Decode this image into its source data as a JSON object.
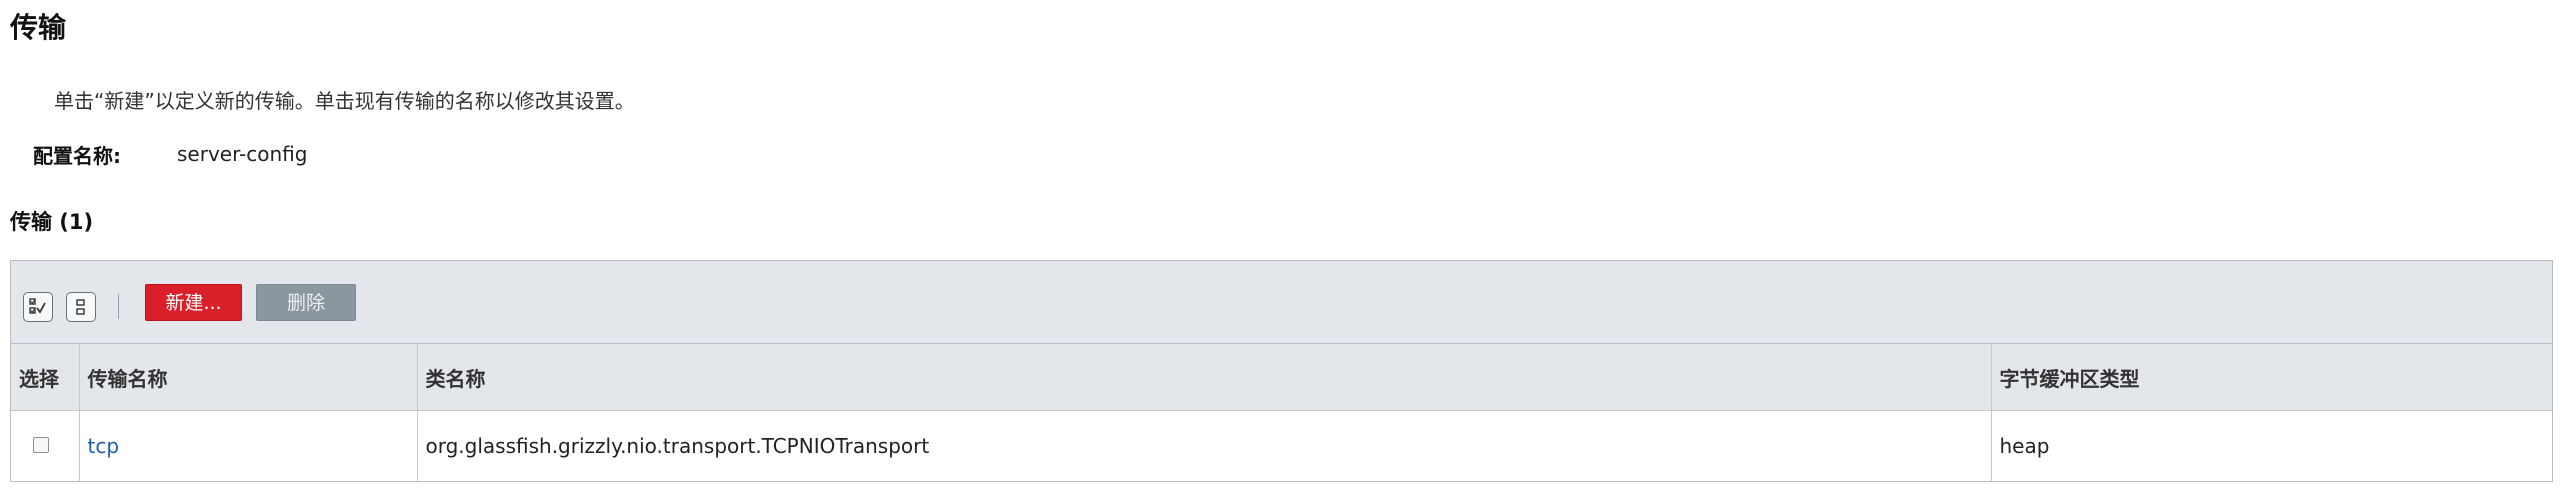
{
  "page": {
    "title": "传输",
    "help_text": "单击“新建”以定义新的传输。单击现有传输的名称以修改其设置。",
    "config_label": "配置名称:",
    "config_value": "server-config"
  },
  "section": {
    "title": "传输 (1)"
  },
  "toolbar": {
    "select_all_icon": "select-all-icon",
    "deselect_all_icon": "deselect-all-icon",
    "new_label": "新建...",
    "delete_label": "删除",
    "new_color": "#d9202a",
    "delete_color": "#8a979f"
  },
  "table": {
    "columns": [
      "选择",
      "传输名称",
      "类名称",
      "字节缓冲区类型"
    ],
    "rows": [
      {
        "selected": false,
        "name": "tcp",
        "class_name": "org.glassfish.grizzly.nio.transport.TCPNIOTransport",
        "byte_buffer_type": "heap"
      }
    ]
  }
}
